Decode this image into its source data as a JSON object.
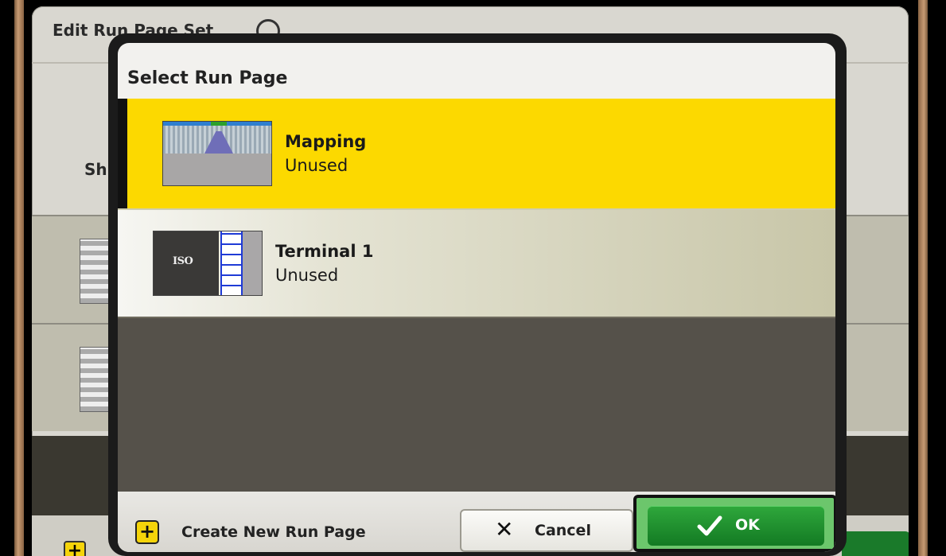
{
  "background": {
    "title": "Edit Run Page Set",
    "partial_label": "Sh"
  },
  "dialog": {
    "title": "Select Run Page",
    "items": [
      {
        "title": "Mapping",
        "status": "Unused",
        "thumbnail": "mapping-thumbnail",
        "selected": true
      },
      {
        "title": "Terminal 1",
        "status": "Unused",
        "thumbnail": "iso-terminal-thumbnail",
        "thumb_text": "ISO",
        "selected": false
      }
    ],
    "footer": {
      "create_label": "Create New Run Page",
      "create_icon": "plus-icon",
      "cancel_label": "Cancel",
      "cancel_icon": "x-icon",
      "ok_label": "OK",
      "ok_icon": "checkmark-icon"
    }
  },
  "colors": {
    "selected_row": "#fcd900",
    "ok_green": "#1f8f2f",
    "plus_yellow": "#f5d40a",
    "list_background": "#55514a"
  }
}
